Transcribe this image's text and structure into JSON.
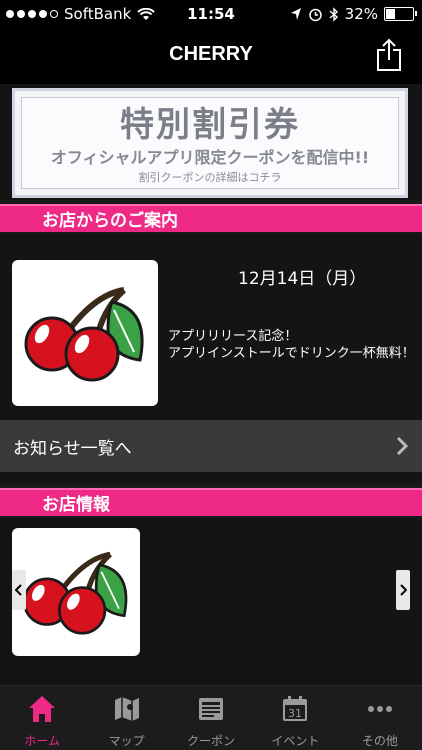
{
  "status_bar": {
    "carrier": "SoftBank",
    "time": "11:54",
    "battery": "32%",
    "battery_level": 0.32
  },
  "nav": {
    "title": "CHERRY"
  },
  "coupon_banner": {
    "headline": "特別割引券",
    "subline": "オフィシャルアプリ限定クーポンを配信中!!",
    "caption": "割引クーポンの詳細はコチラ"
  },
  "announcements": {
    "header": "お店からのご案内",
    "date": "12月14日（月）",
    "body": "アプリリリース記念！\nアプリインストールでドリンク一杯無料！",
    "list_link": "お知らせ一覧へ"
  },
  "shop_info": {
    "header": "お店情報"
  },
  "tabs": [
    {
      "label": "ホーム",
      "icon": "home-icon",
      "active": true
    },
    {
      "label": "マップ",
      "icon": "map-icon",
      "active": false
    },
    {
      "label": "クーポン",
      "icon": "coupon-icon",
      "active": false
    },
    {
      "label": "イベント",
      "icon": "calendar-icon",
      "active": false,
      "day": "31"
    },
    {
      "label": "その他",
      "icon": "more-icon",
      "active": false
    }
  ],
  "colors": {
    "accent": "#ee2a86",
    "background": "#141414"
  }
}
